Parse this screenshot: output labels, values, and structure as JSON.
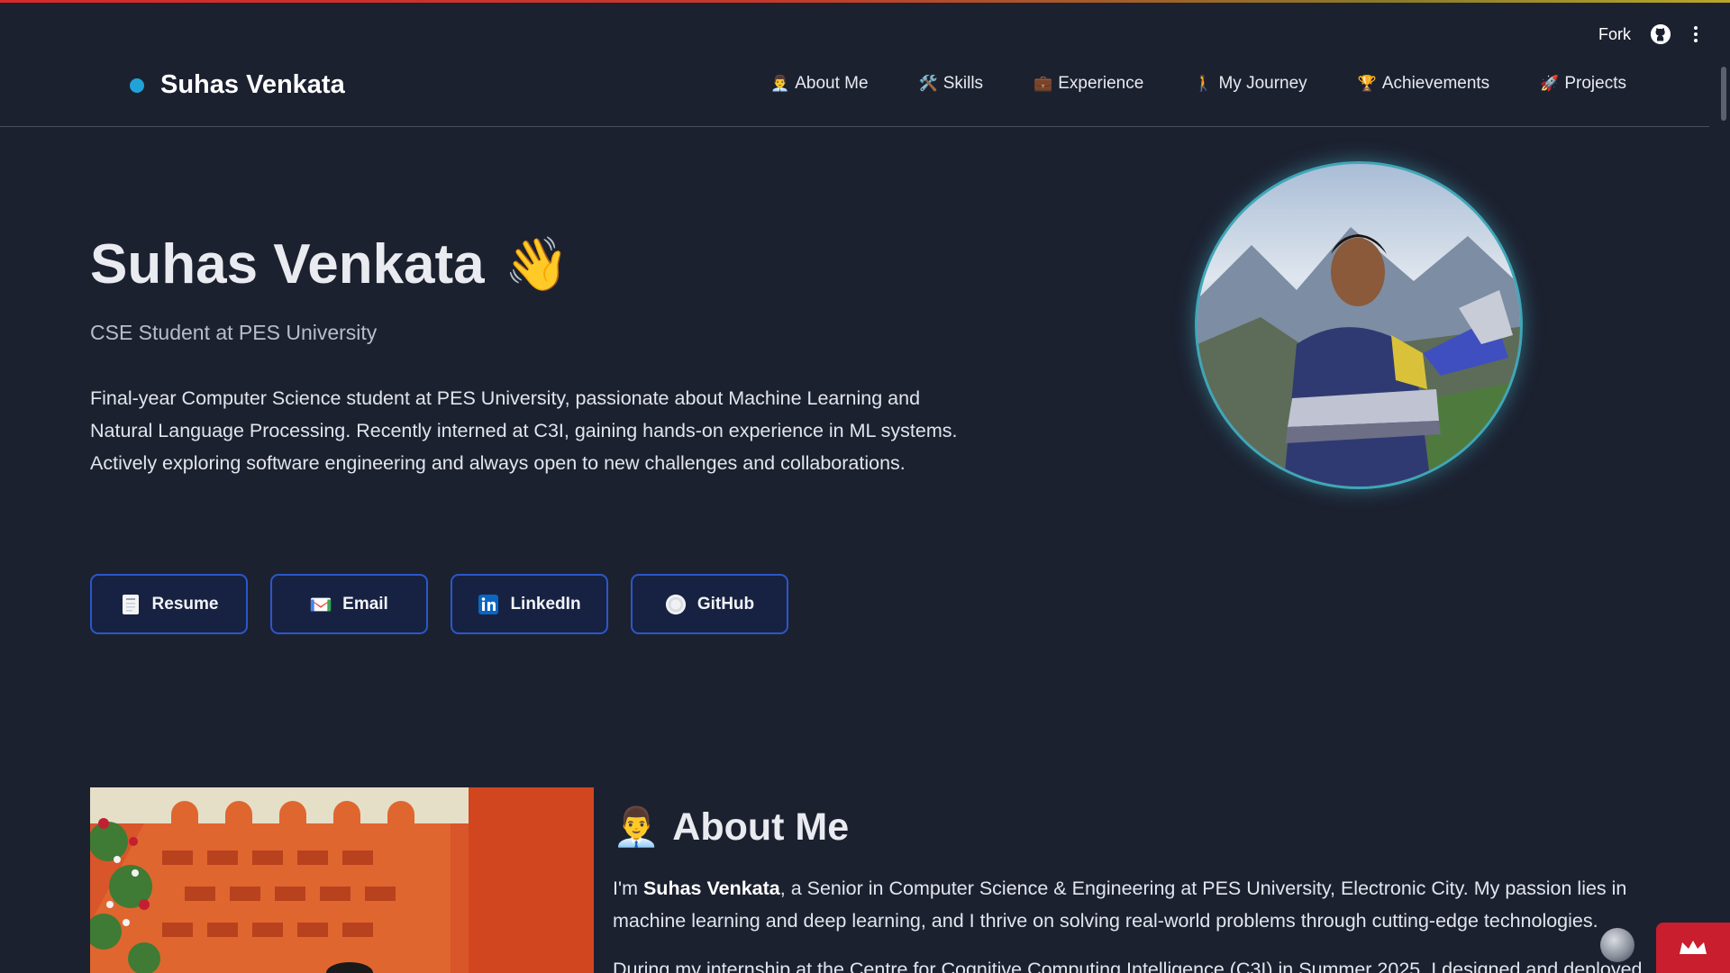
{
  "toolbar": {
    "fork_label": "Fork",
    "github_icon": "github-icon",
    "menu_icon": "kebab-menu-icon"
  },
  "brand": {
    "name": "Suhas Venkata",
    "dot_color": "#1fa3d9"
  },
  "nav": {
    "items": [
      {
        "emoji": "👨‍💼",
        "label": "About Me"
      },
      {
        "emoji": "🛠️",
        "label": "Skills"
      },
      {
        "emoji": "💼",
        "label": "Experience"
      },
      {
        "emoji": "🚶",
        "label": "My Journey"
      },
      {
        "emoji": "🏆",
        "label": "Achievements"
      },
      {
        "emoji": "🚀",
        "label": "Projects"
      }
    ]
  },
  "hero": {
    "name": "Suhas Venkata",
    "wave": "👋",
    "subtitle": "CSE Student at PES University",
    "description": "Final-year Computer Science student at PES University, passionate about Machine Learning and Natural Language Processing. Recently interned at C3I, gaining hands-on experience in ML systems. Actively exploring software engineering and always open to new challenges and collaborations."
  },
  "buttons": {
    "resume": "Resume",
    "email": "Email",
    "linkedin": "LinkedIn",
    "github": "GitHub"
  },
  "about": {
    "emoji": "👨‍💼",
    "heading": "About Me",
    "p1_prefix": "I'm ",
    "p1_bold": "Suhas Venkata",
    "p1_rest": ", a Senior in Computer Science & Engineering at PES University, Electronic City. My passion lies in machine learning and deep learning, and I thrive on solving real-world problems through cutting-edge technologies.",
    "p2": "During my internship at the Centre for Cognitive Computing Intelligence (C3I) in Summer 2025, I designed and deployed"
  },
  "colors": {
    "background": "#1c2130",
    "button_border": "#2b57c9",
    "button_bg": "#172242",
    "accent_ring": "#3fa7b8",
    "badge": "#c81e2e"
  }
}
